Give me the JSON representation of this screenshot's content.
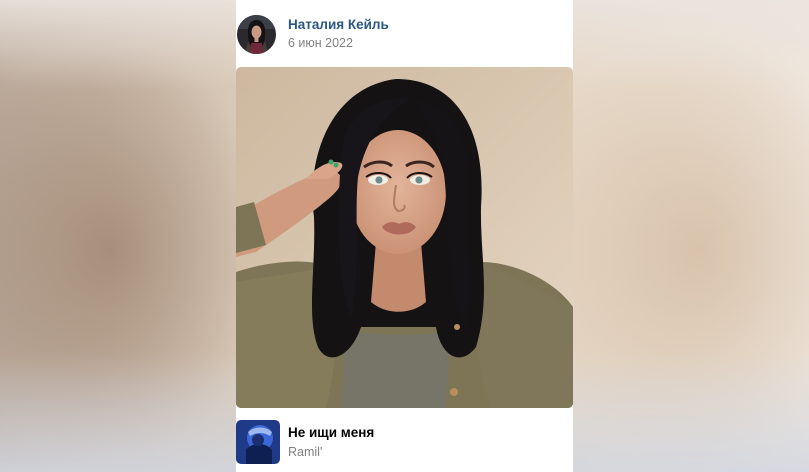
{
  "post": {
    "author": {
      "name": "Наталия Кейль",
      "avatar": "profile-avatar"
    },
    "date": "6 июн 2022",
    "photo": {
      "icon": "portrait-photo"
    },
    "audio": {
      "title": "Не ищи меня",
      "artist": "Ramil'",
      "cover": "album-cover"
    }
  },
  "colors": {
    "author_link": "#2a5885",
    "secondary_text": "#828282",
    "card_background": "#ffffff",
    "photo_background": "#dccab4"
  }
}
